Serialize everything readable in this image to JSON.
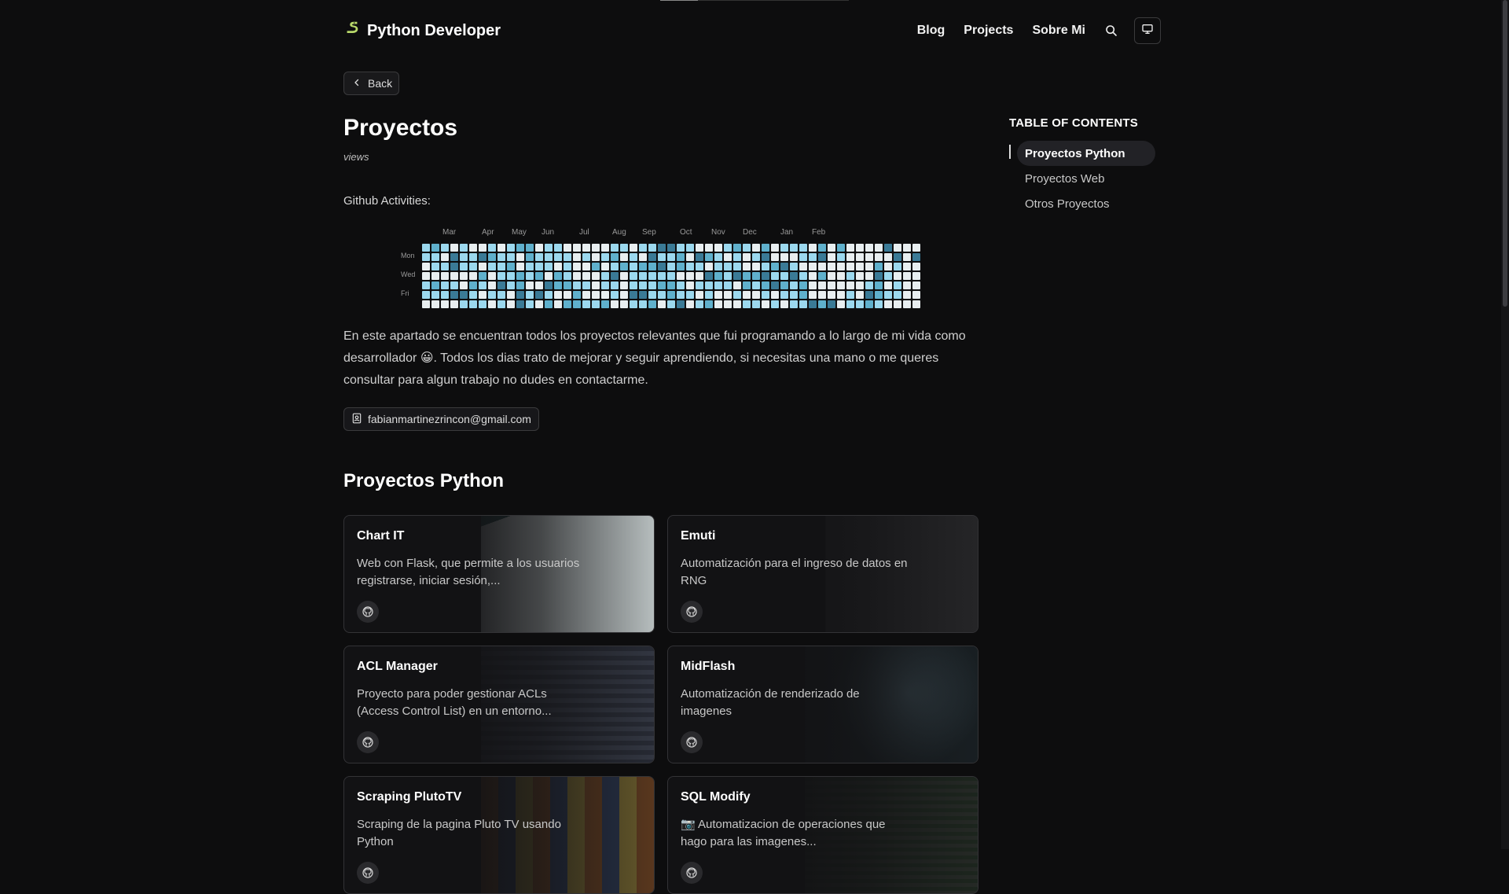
{
  "header": {
    "brand": "Python Developer",
    "brand_icon": "snake-icon",
    "nav": [
      "Blog",
      "Projects",
      "Sobre Mi"
    ],
    "search_icon": "search-icon",
    "theme_icon": "monitor-icon"
  },
  "page": {
    "back_label": "Back",
    "title": "Proyectos",
    "views_label": "views",
    "github_label": "Github Activities:",
    "intro_part1": "En este apartado se encuentran todos los proyectos relevantes que fui programando a lo largo de mi vida como desarrollador",
    "intro_emoji": "😀",
    "intro_part2": ". Todos los dias trato de mejorar y seguir aprendiendo, si necesitas una mano o me queres consultar para algun trabajo no dudes en contactarme.",
    "email": "fabianmartinezrincon@gmail.com",
    "section_title": "Proyectos Python"
  },
  "heatmap": {
    "months": [
      "Mar",
      "Apr",
      "May",
      "Jun",
      "Jul",
      "Aug",
      "Sep",
      "Oct",
      "Nov",
      "Dec",
      "Jan",
      "Feb"
    ],
    "day_labels": [
      "Mon",
      "Wed",
      "Fri"
    ],
    "weeks": 53,
    "colors": [
      "#e8eef0",
      "#9bd8ee",
      "#5fb0cc",
      "#3a7a96"
    ]
  },
  "projects": [
    {
      "title": "Chart IT",
      "desc": "Web con Flask, que permite a los usuarios registrarse, iniciar sesión,...",
      "theme": "light"
    },
    {
      "title": "Emuti",
      "desc": "Automatización para el ingreso de datos en RNG",
      "theme": "terminal"
    },
    {
      "title": "ACL Manager",
      "desc": "Proyecto para poder gestionar ACLs (Access Control List) en un entorno...",
      "theme": "table"
    },
    {
      "title": "MidFlash",
      "desc": "Automatización de renderizado de imagenes",
      "theme": "art"
    },
    {
      "title": "Scraping PlutoTV",
      "desc": "Scraping de la pagina Pluto TV usando Python",
      "theme": "posters"
    },
    {
      "title": "SQL Modify",
      "desc": "📷 Automatizacion de operaciones que hago para las imagenes...",
      "theme": "sql"
    }
  ],
  "toc": {
    "title": "TABLE OF CONTENTS",
    "items": [
      "Proyectos Python",
      "Proyectos Web",
      "Otros Proyectos"
    ],
    "active_index": 0
  }
}
